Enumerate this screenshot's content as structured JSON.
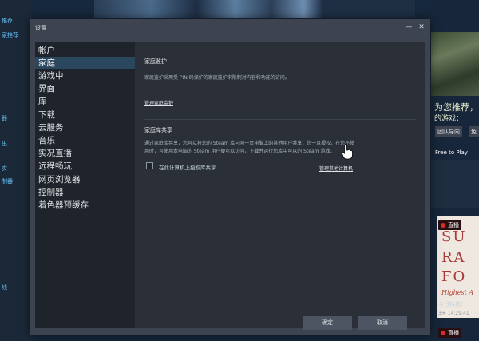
{
  "background": {
    "left_links": [
      "推荐",
      "家推荐",
      "器",
      "出",
      "实",
      "制器",
      "线"
    ],
    "right": {
      "title": "为您推荐，",
      "subtitle": "的游戏：",
      "buttons": [
        "团队导向",
        "免"
      ],
      "free_to_play": "Free to Play",
      "live_label": "直播",
      "poster_lines": [
        "SU",
        "RA",
        "FO"
      ],
      "poster_script": "Highest A",
      "today_label": "今日特惠!",
      "date_text": "3天 14:29:41"
    }
  },
  "dialog": {
    "title": "设置",
    "minimize": "—",
    "close": "✕",
    "menu": [
      "帐户",
      "家庭",
      "游戏中",
      "界面",
      "库",
      "下载",
      "云服务",
      "音乐",
      "实况直播",
      "远程畅玩",
      "网页浏览器",
      "控制器",
      "着色器预缓存"
    ],
    "active_index": 1,
    "family_view": {
      "title": "家庭监护",
      "description": "家庭监护采用受 PIN 码保护的家庭监护来限制对内容和功能的访问。",
      "link": "管理家庭监护"
    },
    "family_sharing": {
      "title": "家庭库共享",
      "description_1": "通过家庭库共享，您可以将您的 Steam 库与同一台电脑上的其他用户共享，您一旦授权，在您不使",
      "description_2": "用时，可使用本电脑的 Steam 用户便可以访问，下载并运行您库中可以的 Steam 游戏。",
      "checkbox_label": "在此计算机上授权库共享",
      "link": "管理其他计算机"
    },
    "ok_label": "确定",
    "cancel_label": "取消"
  }
}
